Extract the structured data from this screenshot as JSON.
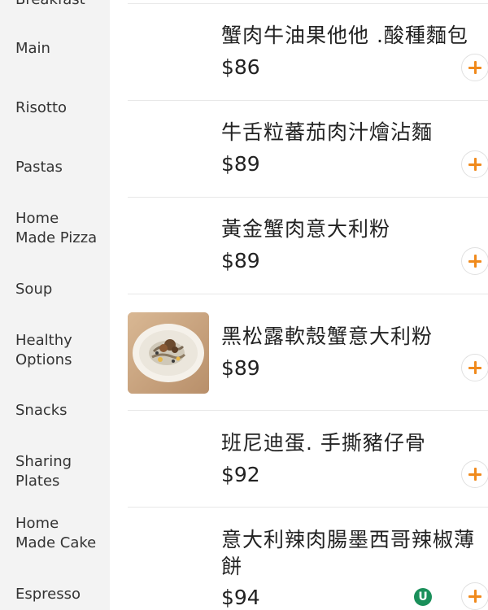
{
  "sidebar": {
    "categories": [
      {
        "label": "Breakfast"
      },
      {
        "label": "Main"
      },
      {
        "label": "Risotto"
      },
      {
        "label": "Pastas"
      },
      {
        "label": "Home\nMade Pizza"
      },
      {
        "label": "Soup"
      },
      {
        "label": "Healthy\nOptions"
      },
      {
        "label": "Snacks"
      },
      {
        "label": "Sharing\nPlates"
      },
      {
        "label": "Home\nMade Cake"
      },
      {
        "label": "Espresso"
      }
    ]
  },
  "menu": {
    "items": [
      {
        "name": "蟹肉牛油果他他 .酸種麵包",
        "price": "$86"
      },
      {
        "name": "牛舌粒蕃茄肉汁燴沾麵",
        "price": "$89"
      },
      {
        "name": "黃金蟹肉意大利粉",
        "price": "$89"
      },
      {
        "name": "黑松露軟殼蟹意大利粉",
        "price": "$89"
      },
      {
        "name": "班尼迪蛋. 手撕豬仔骨",
        "price": "$92"
      },
      {
        "name": "意大利辣肉腸墨西哥辣椒薄餅",
        "price": "$94"
      }
    ]
  },
  "badge": {
    "letter": "U"
  },
  "colors": {
    "accent": "#f08a1c",
    "sidebar_bg": "#f3f3f3",
    "divider": "#e8e8e8",
    "badge": "#1a8f5a"
  }
}
